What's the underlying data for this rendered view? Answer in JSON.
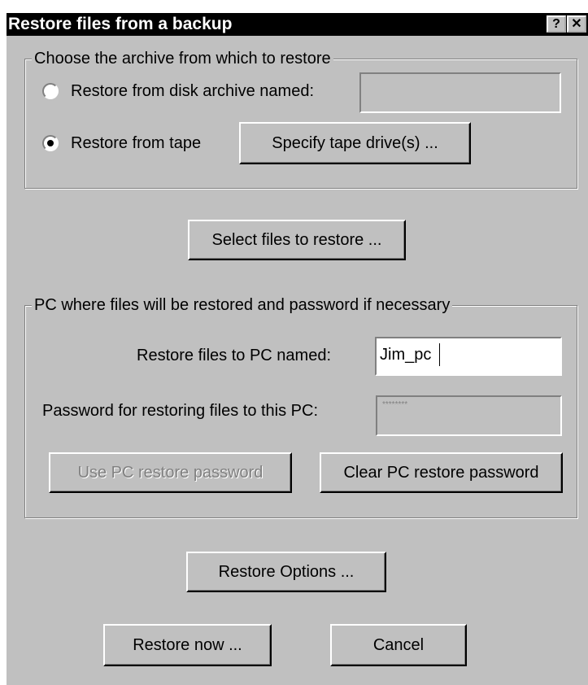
{
  "window": {
    "title": "Restore files from a backup",
    "help_glyph": "?",
    "close_glyph": "✕"
  },
  "archive_group": {
    "legend": "Choose the archive from which to restore",
    "disk_radio_label": "Restore from disk archive named:",
    "disk_archive_value": "",
    "tape_radio_label": "Restore from tape",
    "specify_tape_button": "Specify tape drive(s) ...",
    "selected": "tape"
  },
  "select_files_button": "Select files to restore ...",
  "pc_group": {
    "legend": "PC where files will be restored and password if necessary",
    "pc_name_label": "Restore files to PC named:",
    "pc_name_value": "Jim_pc",
    "password_label": "Password for restoring files to this PC:",
    "password_mask": "********",
    "use_password_button": "Use PC restore password",
    "clear_password_button": "Clear PC restore password"
  },
  "restore_options_button": "Restore Options ...",
  "restore_now_button": "Restore now ...",
  "cancel_button": "Cancel",
  "colors": {
    "face": "#c0c0c0",
    "titlebar": "#000000",
    "disabled_text": "#808080"
  }
}
